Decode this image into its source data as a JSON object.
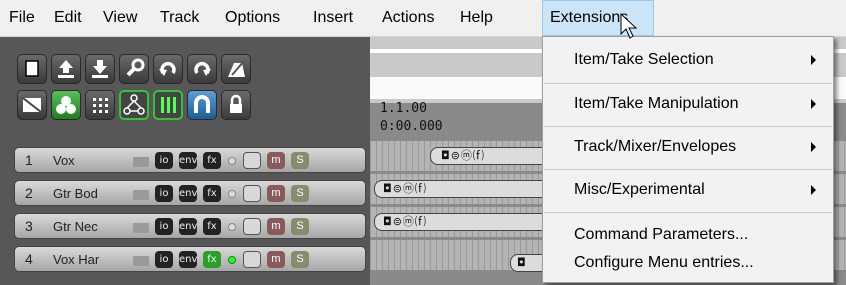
{
  "menubar": {
    "items": [
      {
        "label": "File"
      },
      {
        "label": "Edit"
      },
      {
        "label": "View"
      },
      {
        "label": "Track"
      },
      {
        "label": "Options"
      },
      {
        "label": "Insert"
      },
      {
        "label": "Actions"
      },
      {
        "label": "Help"
      },
      {
        "label": "Extensions"
      }
    ]
  },
  "ruler": {
    "bar": "1.1.00",
    "time": "0:00.000"
  },
  "tracks": [
    {
      "num": "1",
      "name": "Vox"
    },
    {
      "num": "2",
      "name": "Gtr Bod"
    },
    {
      "num": "3",
      "name": "Gtr Nec"
    },
    {
      "num": "4",
      "name": "Vox Har"
    }
  ],
  "track_buttons": {
    "io": "io",
    "env": "env",
    "fx": "fx",
    "mute": "m",
    "solo": "S"
  },
  "extensions_menu": {
    "items": [
      {
        "label": "Item/Take Selection",
        "submenu": true
      },
      {
        "label": "Item/Take Manipulation",
        "submenu": true
      },
      {
        "label": "Track/Mixer/Envelopes",
        "submenu": true
      },
      {
        "label": "Misc/Experimental",
        "submenu": true
      },
      {
        "label": "Command Parameters...",
        "submenu": false
      },
      {
        "label": "Configure Menu entries...",
        "submenu": false
      }
    ]
  },
  "colors": {
    "accent_green": "#36c236",
    "menu_highlight": "#cce4f7"
  },
  "icons": [
    "new-project-icon",
    "upload-icon",
    "download-icon",
    "wrench-icon",
    "undo-icon",
    "redo-icon",
    "metronome-icon",
    "envelope-icon",
    "group-icon",
    "grid-icon",
    "snap-icon",
    "ripple-icon",
    "loop-icon",
    "lock-icon"
  ]
}
